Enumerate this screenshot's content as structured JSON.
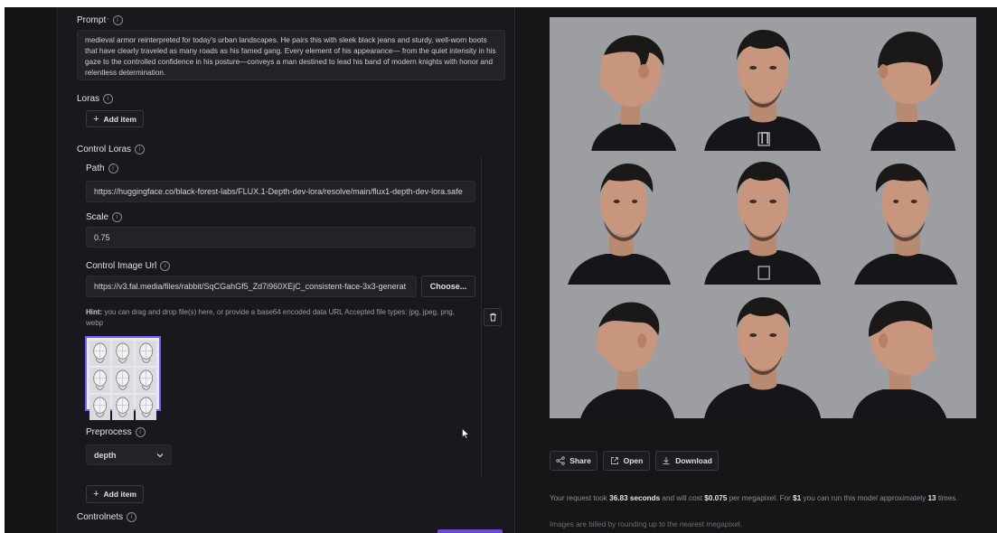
{
  "left_panel": {
    "prompt": {
      "label": "Prompt",
      "required": "*",
      "text": "medieval armor reinterpreted for today's urban landscapes. He pairs this with sleek black jeans and sturdy, well-worn boots that have clearly traveled as many roads as his famed gang. Every element of his appearance— from the quiet intensity in his gaze to the controlled confidence in his posture—conveys a man destined to lead his band of modern knights with honor and relentless determination."
    },
    "loras": {
      "label": "Loras",
      "add_label": "Add item"
    },
    "control_loras": {
      "label": "Control Loras",
      "path_label": "Path",
      "path_value": "https://huggingface.co/black-forest-labs/FLUX.1-Depth-dev-lora/resolve/main/flux1-depth-dev-lora.safe",
      "scale_label": "Scale",
      "scale_value": "0.75",
      "control_image_label": "Control Image Url",
      "control_image_value": "https://v3.fal.media/files/rabbit/SqCGahGf5_Zd7i960XEjC_consistent-face-3x3-generat",
      "choose_label": "Choose...",
      "hint_prefix": "Hint:",
      "hint_text": " you can drag and drop file(s) here, or provide a base64 encoded data URL Accepted file types: jpg, jpeg, png, webp",
      "preprocess_label": "Preprocess",
      "preprocess_value": "depth",
      "add_label": "Add item"
    },
    "controlnets": {
      "label": "Controlnets"
    }
  },
  "right_panel": {
    "actions": {
      "share": "Share",
      "open": "Open",
      "download": "Download"
    },
    "request_info": {
      "part1": "Your request took ",
      "time": "36.83 seconds",
      "part2": " and will cost ",
      "cost": "$0.075",
      "part3": " per megapixel. For ",
      "budget": "$1",
      "part4": " you can run this model approximately ",
      "runs": "13",
      "part5": " times."
    },
    "billing_note": "Images are billed by rounding up to the nearest megapixel."
  },
  "colors": {
    "accent": "#7b5cff",
    "background": "#161619",
    "panel": "#19191d",
    "field": "#232327",
    "result_bg": "#9c9da0"
  },
  "icons": {
    "info": "info-circle-icon",
    "plus": "plus-icon",
    "trash": "trash-icon",
    "chevron": "chevron-down-icon",
    "share": "share-icon",
    "open": "external-link-icon",
    "download": "download-icon"
  }
}
